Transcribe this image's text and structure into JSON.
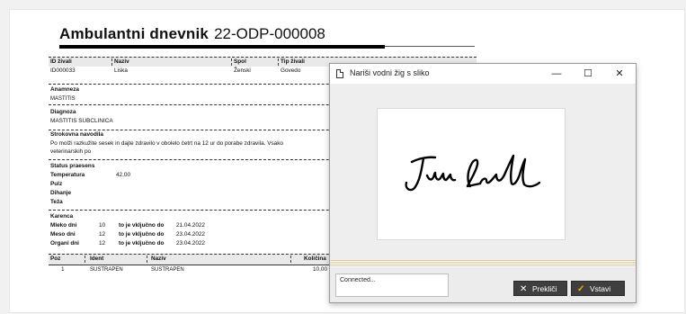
{
  "document": {
    "title_label": "Ambulantni dnevnik",
    "title_number": "22-ODP-000008",
    "table": {
      "headers": {
        "id": "ID živali",
        "name": "Naziv",
        "sex": "Spol",
        "type": "Tip živali"
      },
      "row": {
        "id": "ID000033",
        "name": "Liska",
        "sex": "Ženski",
        "type": "Govedo"
      }
    },
    "anamnesis": {
      "label": "Anamneza",
      "value": "MASTITIS"
    },
    "diagnosis": {
      "label": "Diagnoza",
      "value": "MASTITIS SUBCLINICA"
    },
    "instructions": {
      "label": "Strokovna navodila",
      "line1": "Po molži razkužite sesek in dajte zdravilo v obolelo četrt na 12 ur do porabe zdravila. Vsako",
      "line2": "veterinarskih po"
    },
    "status": {
      "label": "Status praesens",
      "rows": [
        {
          "label": "Temperatura",
          "value": "42,00"
        },
        {
          "label": "Pulz",
          "value": ""
        },
        {
          "label": "Dihanje",
          "value": ""
        },
        {
          "label": "Teža",
          "value": ""
        }
      ]
    },
    "karenca": {
      "label": "Karenca",
      "rows": [
        {
          "label": "Mleko dni",
          "days": "10",
          "text": "to je vključno do",
          "date": "21.04.2022"
        },
        {
          "label": "Meso dni",
          "days": "12",
          "text": "to je vključno do",
          "date": "23.04.2022"
        },
        {
          "label": "Organi dni",
          "days": "12",
          "text": "to je vključno do",
          "date": "23.04.2022"
        }
      ]
    },
    "items": {
      "headers": {
        "poz": "Poz",
        "ident": "Ident",
        "naziv": "Naziv",
        "kolicina": "Količina"
      },
      "row": {
        "poz": "1",
        "ident": "SUSTRAPEN",
        "naziv": "SUSTRAPEN",
        "kolicina": "10,00"
      }
    }
  },
  "dialog": {
    "title": "Nariši vodni žig s sliko",
    "minimize": "—",
    "maximize": "☐",
    "close": "✕",
    "status_text": "Connected...",
    "cancel_label": "Prekliči",
    "insert_label": "Vstavi",
    "accent": "#f2b400"
  }
}
